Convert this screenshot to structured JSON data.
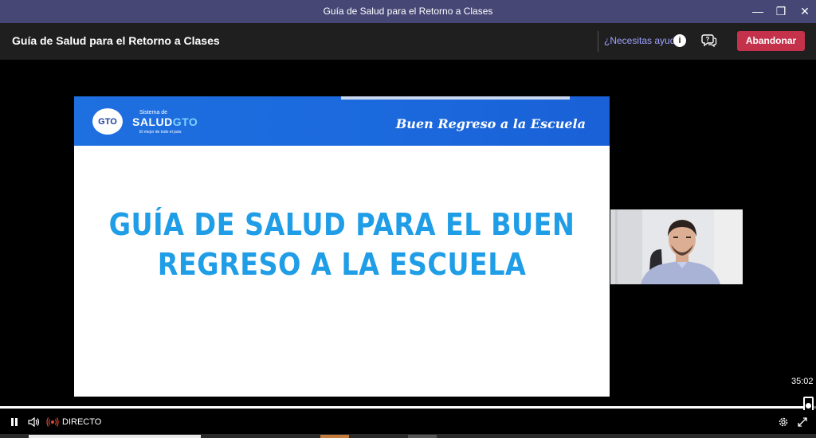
{
  "window": {
    "title": "Guía de Salud para el Retorno a Clases",
    "minimize_glyph": "—",
    "restore_glyph": "❐",
    "close_glyph": "✕"
  },
  "header": {
    "meeting_title": "Guía de Salud para el Retorno a Clases",
    "help_link": "¿Necesitas ayuda?",
    "info_glyph": "i",
    "leave_button": "Abandonar"
  },
  "slide": {
    "gto_logo": "GTO",
    "salud_logo_top": "Sistema de",
    "salud_logo_main": "SALUD",
    "salud_logo_gto": "GTO",
    "salud_logo_tagline": "El mejor de todo el país",
    "banner_text": "Buen Regreso a la Escuela",
    "headline_line1": "GUÍA DE SALUD PARA EL BUEN",
    "headline_line2": "REGRESO A LA ESCUELA"
  },
  "player": {
    "timecode": "35:02",
    "live_label": "DIRECTO",
    "progress_fraction": 0.985
  },
  "colors": {
    "titlebar": "#464775",
    "leave_button": "#c4314b",
    "live_icon": "#e0453a",
    "slide_banner": "#1b69dd",
    "headline": "#1f9de6"
  },
  "icons": {
    "pause": "pause-icon",
    "volume": "volume-icon",
    "live": "live-broadcast-icon",
    "settings": "gear-icon",
    "fullscreen": "expand-icon",
    "info": "info-icon",
    "chat_help": "chat-help-icon"
  }
}
